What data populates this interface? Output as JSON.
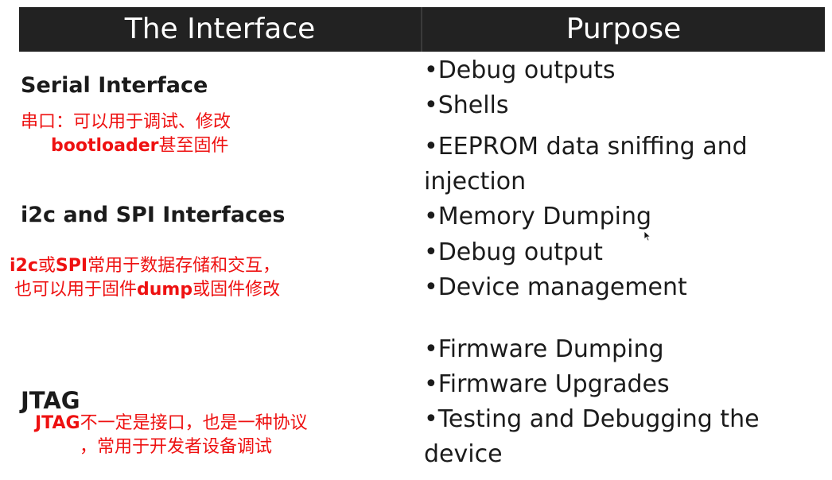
{
  "header": {
    "col_interface": "The Interface",
    "col_purpose": "Purpose"
  },
  "rows": [
    {
      "title": "Serial Interface",
      "note_line1": "串口：可以用于调试、修改",
      "note_line2_bold": "bootloader",
      "note_line2_rest": "甚至固件",
      "purposes": [
        "•Debug outputs",
        "•Shells"
      ]
    },
    {
      "title": "i2c and SPI Interfaces",
      "note_line1_bold_a": "i2c",
      "note_line1_mid": "或",
      "note_line1_bold_b": "SPI",
      "note_line1_rest": "常用于数据存储和交互，",
      "note_line2_pre": "也可以用于固件",
      "note_line2_bold": "dump",
      "note_line2_rest": "或固件修改",
      "purposes": [
        "•EEPROM data sniffing and",
        "injection",
        "•Memory Dumping",
        "•Debug output",
        "•Device management"
      ]
    },
    {
      "title": "JTAG",
      "note_line1_bold": "JTAG",
      "note_line1_rest": "不一定是接口，也是一种协议",
      "note_line2": "，常用于开发者设备调试",
      "purposes": [
        "•Firmware Dumping",
        "•Firmware Upgrades",
        "•Testing and Debugging the",
        "device"
      ]
    }
  ],
  "colors": {
    "header_bg": "#222222",
    "note_red": "#ee1111"
  }
}
